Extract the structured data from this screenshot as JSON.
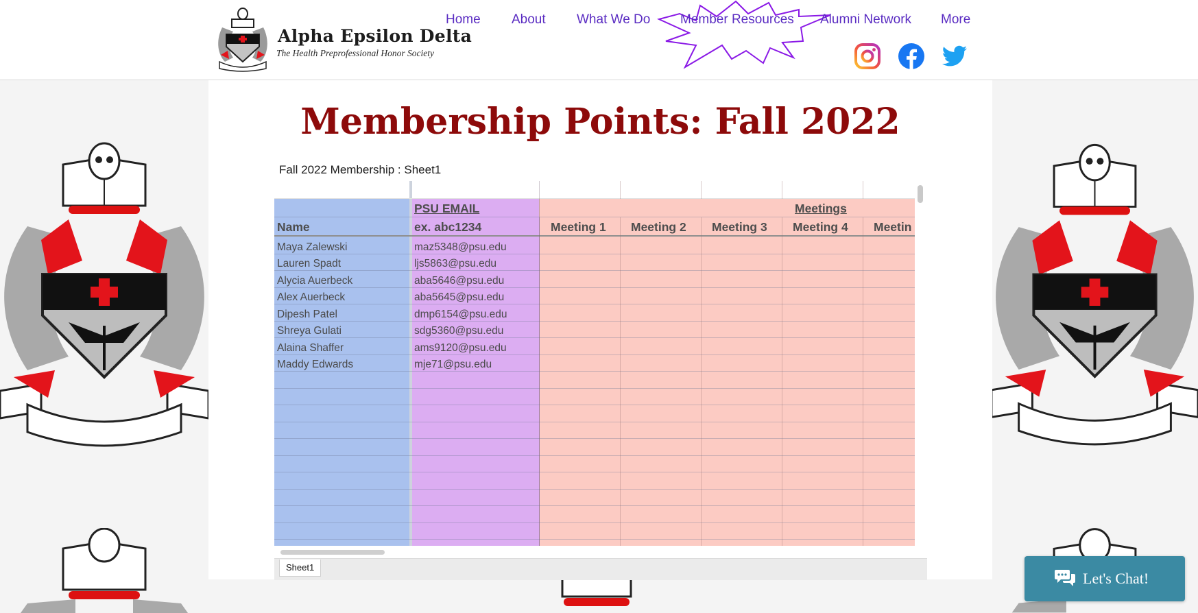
{
  "colors": {
    "nav": "#5a2cc2",
    "title": "#8d0a0a",
    "name_column": "#a9c1ee",
    "email_column": "#dcadf2",
    "meetings_column": "#fccbc3",
    "chat_button": "#3b8aa3"
  },
  "header": {
    "logo": {
      "name": "Alpha Epsilon Delta",
      "tagline": "The Health Preprofessional Honor Society",
      "icon": "crest-icon"
    },
    "nav": [
      {
        "label": "Home"
      },
      {
        "label": "About"
      },
      {
        "label": "What We Do"
      },
      {
        "label": "Member Resources"
      },
      {
        "label": "Alumni Network"
      },
      {
        "label": "More"
      }
    ],
    "social": [
      "instagram-icon",
      "facebook-icon",
      "twitter-icon"
    ]
  },
  "main": {
    "title": "Membership Points: Fall 2022",
    "sheet_title": "Fall 2022 Membership : Sheet1",
    "sheet": {
      "header_row_1": {
        "email_title": "PSU EMAIL",
        "meetings_title": "Meetings"
      },
      "header_row_2": {
        "name": "Name",
        "email_example": "ex. abc1234",
        "meetings": [
          "Meeting 1",
          "Meeting 2",
          "Meeting 3",
          "Meeting 4",
          "Meetin"
        ]
      },
      "rows": [
        {
          "name": "Maya Zalewski",
          "email": "maz5348@psu.edu"
        },
        {
          "name": "Lauren Spadt",
          "email": "ljs5863@psu.edu"
        },
        {
          "name": "Alycia Auerbeck",
          "email": "aba5646@psu.edu"
        },
        {
          "name": "Alex Auerbeck",
          "email": "aba5645@psu.edu"
        },
        {
          "name": "Dipesh Patel",
          "email": "dmp6154@psu.edu"
        },
        {
          "name": "Shreya Gulati",
          "email": "sdg5360@psu.edu"
        },
        {
          "name": "Alaina Shaffer",
          "email": "ams9120@psu.edu"
        },
        {
          "name": "Maddy Edwards",
          "email": "mje71@psu.edu"
        }
      ],
      "tab_label": "Sheet1"
    }
  },
  "chat": {
    "label": "Let's Chat!",
    "icon": "chat-bubbles-icon"
  }
}
